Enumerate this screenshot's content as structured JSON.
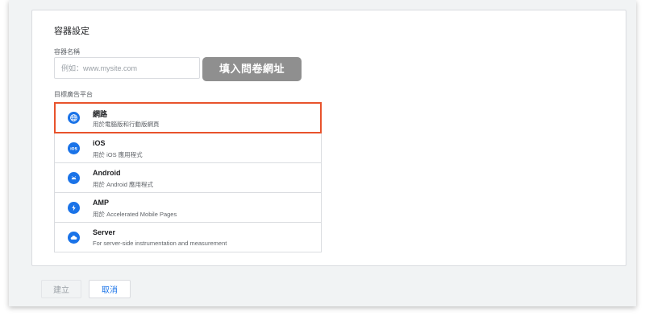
{
  "container_settings": {
    "title": "容器設定",
    "name_field": {
      "label": "容器名稱",
      "placeholder": "例如：www.mysite.com",
      "value": ""
    },
    "annotation": "填入問卷網址",
    "platform_label": "目標廣告平台",
    "platforms": [
      {
        "name": "網路",
        "description": "用於電腦版和行動版網頁",
        "icon": "globe-icon",
        "selected": true
      },
      {
        "name": "iOS",
        "description": "用於 iOS 應用程式",
        "icon": "ios-icon",
        "selected": false
      },
      {
        "name": "Android",
        "description": "用於 Android 應用程式",
        "icon": "android-icon",
        "selected": false
      },
      {
        "name": "AMP",
        "description": "用於 Accelerated Mobile Pages",
        "icon": "lightning-icon",
        "selected": false
      },
      {
        "name": "Server",
        "description": "For server-side instrumentation and measurement",
        "icon": "cloud-icon",
        "selected": false
      }
    ]
  },
  "actions": {
    "create_label": "建立",
    "cancel_label": "取消"
  },
  "colors": {
    "accent": "#1a73e8",
    "highlight_border": "#e8532c",
    "annotation_bg": "#8f8f8f"
  }
}
